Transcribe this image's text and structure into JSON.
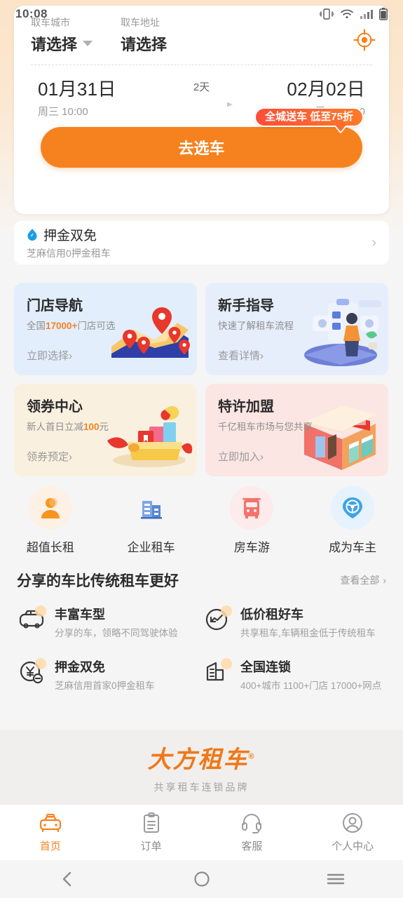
{
  "statusbar": {
    "time": "10:08",
    "icons": [
      "vibrate-icon",
      "wifi-icon",
      "signal-icon",
      "battery-icon"
    ]
  },
  "search_card": {
    "pickup_city_label": "取车城市",
    "pickup_addr_label": "取车地址",
    "pickup_city_value": "请选择",
    "pickup_addr_value": "请选择",
    "locate_icon": "locate-target-icon",
    "start_date": "01月31日",
    "start_sub": "周三 10:00",
    "duration": "2天",
    "end_date": "02月02日",
    "end_sub": "周五 10:00",
    "cta_label": "去选车",
    "cta_badge": "全城送车 低至75折"
  },
  "deposit": {
    "icon": "sesame-credit-icon",
    "title": "押金双免",
    "subtitle": "芝麻信用0押金租车",
    "chevron": "›"
  },
  "promos": [
    {
      "title": "门店导航",
      "sub_pre": "全国",
      "sub_hl": "17000+",
      "sub_post": "门店可选",
      "link": "立即选择",
      "link_arrow": "›",
      "art": "map-pins-illustration",
      "theme": "pc-blue"
    },
    {
      "title": "新手指导",
      "sub_pre": "快速了解租车流程",
      "sub_hl": "",
      "sub_post": "",
      "link": "查看详情",
      "link_arrow": "›",
      "art": "tutorial-person-illustration",
      "theme": "pc-blue2"
    },
    {
      "title": "领券中心",
      "sub_pre": "新人首日立减",
      "sub_hl": "100",
      "sub_post": "元",
      "link": "领券预定",
      "link_arrow": "›",
      "art": "gift-coupon-illustration",
      "theme": "pc-cream"
    },
    {
      "title": "特许加盟",
      "sub_pre": "千亿租车市场与您共享",
      "sub_hl": "",
      "sub_post": "",
      "link": "立即加入",
      "link_arrow": "›",
      "art": "storefront-illustration",
      "theme": "pc-pink"
    }
  ],
  "quick_links": [
    {
      "label": "超值长租",
      "icon": "person-icon",
      "bg": "#fdf0e4",
      "color": "#f7941d"
    },
    {
      "label": "企业租车",
      "icon": "buildings-icon",
      "bg": "#e8effb",
      "color": "#6f9fe8"
    },
    {
      "label": "房车游",
      "icon": "bus-icon",
      "bg": "#fdeaea",
      "color": "#f4726d"
    },
    {
      "label": "成为车主",
      "icon": "steering-wheel-icon",
      "bg": "#e6f2fd",
      "color": "#4aa8e8"
    }
  ],
  "section": {
    "title": "分享的车比传统租车更好",
    "more": "查看全部",
    "more_arrow": "›"
  },
  "benefits": [
    {
      "title": "丰富车型",
      "sub": "分享的车，领略不同驾驶体验",
      "icon": "car-icon"
    },
    {
      "title": "低价租好车",
      "sub": "共享租车,车辆租金低于传统租车",
      "icon": "trend-down-icon"
    },
    {
      "title": "押金双免",
      "sub": "芝麻信用首家0押金租车",
      "icon": "yuan-minus-icon"
    },
    {
      "title": "全国连锁",
      "sub": "400+城市 1100+门店 17000+网点",
      "icon": "building-chain-icon"
    }
  ],
  "footer": {
    "logo": "大方租车",
    "registered": "®",
    "tagline": "共享租车连锁品牌"
  },
  "tabbar": [
    {
      "label": "首页",
      "icon": "taxi-icon",
      "active": true
    },
    {
      "label": "订单",
      "icon": "clipboard-icon",
      "active": false
    },
    {
      "label": "客服",
      "icon": "headset-icon",
      "active": false
    },
    {
      "label": "个人中心",
      "icon": "user-circle-icon",
      "active": false
    }
  ],
  "navbar": [
    {
      "name": "back",
      "icon": "chevron-left-icon"
    },
    {
      "name": "home",
      "icon": "circle-icon"
    },
    {
      "name": "recents",
      "icon": "hamburger-icon"
    }
  ],
  "colors": {
    "brand_orange": "#f5821f",
    "badge_red": "#ff4d3a",
    "text_dark": "#2b2b2b",
    "text_muted": "#9a9a9a"
  }
}
